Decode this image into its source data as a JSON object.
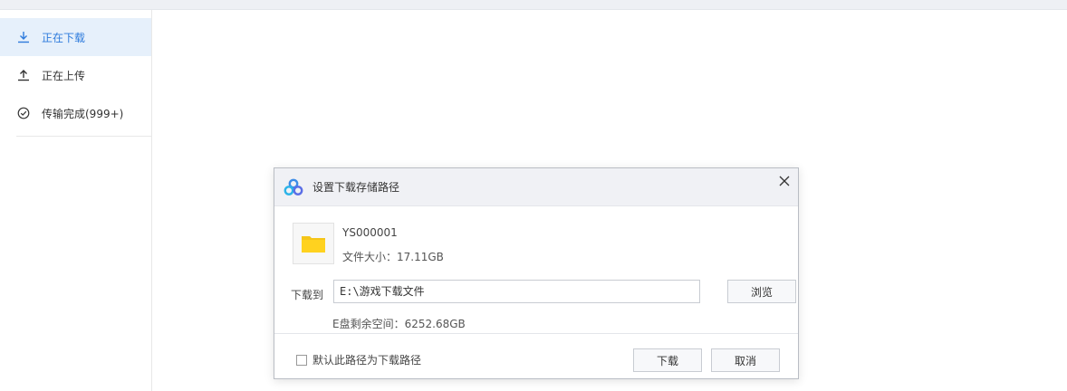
{
  "sidebar": {
    "items": [
      {
        "label": "正在下载",
        "icon": "download-icon",
        "active": true
      },
      {
        "label": "正在上传",
        "icon": "upload-icon",
        "active": false
      },
      {
        "label": "传输完成(999+)",
        "icon": "check-circle-icon",
        "active": false
      }
    ]
  },
  "dialog": {
    "title": "设置下载存储路径",
    "logo_icon": "cloud-logo-icon",
    "close_icon": "close-icon",
    "file": {
      "name": "YS000001",
      "size_label": "文件大小：",
      "size_value": "17.11GB",
      "icon": "folder-icon"
    },
    "download_to_label": "下载到",
    "path_value": "E:\\游戏下载文件",
    "browse_label": "浏览",
    "free_space_label": "E盘剩余空间：",
    "free_space_value": "6252.68GB",
    "default_path_checkbox_label": "默认此路径为下载路径",
    "download_button": "下载",
    "cancel_button": "取消"
  },
  "colors": {
    "accent": "#2e7bdc",
    "active_bg": "#e6f0fb",
    "folder": "#f5c518"
  }
}
